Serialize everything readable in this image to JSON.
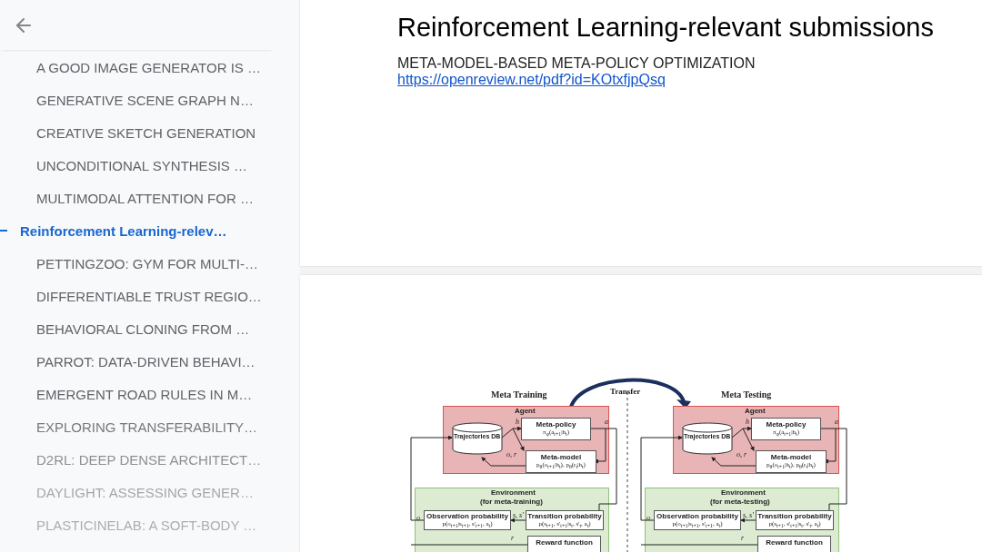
{
  "outline": {
    "items": [
      {
        "label": "A GOOD IMAGE GENERATOR IS …",
        "selected": false
      },
      {
        "label": "GENERATIVE SCENE GRAPH N…",
        "selected": false
      },
      {
        "label": "CREATIVE SKETCH GENERATION",
        "selected": false
      },
      {
        "label": "UNCONDITIONAL SYNTHESIS …",
        "selected": false
      },
      {
        "label": "MULTIMODAL ATTENTION FOR …",
        "selected": false
      },
      {
        "label": "Reinforcement Learning-relev…",
        "selected": true
      },
      {
        "label": "PETTINGZOO: GYM FOR MULTI-…",
        "selected": false
      },
      {
        "label": "DIFFERENTIABLE TRUST REGIO…",
        "selected": false
      },
      {
        "label": "BEHAVIORAL CLONING FROM …",
        "selected": false
      },
      {
        "label": "PARROT: DATA-DRIVEN BEHAVI…",
        "selected": false
      },
      {
        "label": "EMERGENT ROAD RULES IN M…",
        "selected": false
      },
      {
        "label": "EXPLORING TRANSFERABILITY…",
        "selected": false
      },
      {
        "label": "D2RL: DEEP DENSE ARCHITECT…",
        "selected": false
      },
      {
        "label": "DAYLIGHT: ASSESSING GENER…",
        "selected": false
      },
      {
        "label": "PLASTICINELAB: A SOFT-BODY …",
        "selected": false
      }
    ]
  },
  "document": {
    "heading": "Reinforcement Learning-relevant submissions",
    "paper_title": "META-MODEL-BASED META-POLICY OPTIMIZATION",
    "link": "https://openreview.net/pdf?id=KOtxfjpQsq",
    "figure": {
      "transfer": "Transfer",
      "panels": [
        {
          "title": "Meta Training",
          "agent": "Agent",
          "db": "Trajectories DB",
          "policy": "Meta-policy",
          "policy_formula": "π$_{φ}$(a$_{t+1}$|h$_{t}$)",
          "model": "Meta-model",
          "model_formula": "p$_{θ}$(o$_{t+1}$|h$_{t}$), p$_{θ}$(r$_{t}$|h$_{t}$)",
          "environment": "Environment",
          "environment_note": "(for meta-training)",
          "observation": "Observation probability",
          "observation_formula": "p(o$_{t+1}$|s$_{t+1}$, s'$_{t+1}$, a$_{t}$)",
          "transition": "Transition probability",
          "transition_formula": "p(s$_{t+1}$, s'$_{t+1}$|s$_{t}$, s'$_{t}$, a$_{t}$)",
          "reward": "Reward function",
          "signals": [
            "h",
            "a",
            "o, r",
            "o",
            "s, s'",
            "r"
          ]
        },
        {
          "title": "Meta Testing",
          "agent": "Agent",
          "db": "Trajectories DB",
          "policy": "Meta-policy",
          "policy_formula": "π$_{φ}$(a$_{t+1}$|h$_{t}$)",
          "model": "Meta-model",
          "model_formula": "p$_{θ}$(o$_{t+1}$|h$_{t}$), p$_{θ}$(r$_{t}$|h$_{t}$)",
          "environment": "Environment",
          "environment_note": "(for meta-testing)",
          "observation": "Observation probability",
          "observation_formula": "p(o$_{t+1}$|s$_{t+1}$, s'$_{t+1}$, a$_{t}$)",
          "transition": "Transition probability",
          "transition_formula": "p(s$_{t+1}$, s'$_{t+1}$|s$_{t}$, s'$_{t}$, a$_{t}$)",
          "reward": "Reward function",
          "signals": [
            "h",
            "a",
            "o, r",
            "o",
            "s, s'",
            "r"
          ]
        }
      ]
    }
  }
}
